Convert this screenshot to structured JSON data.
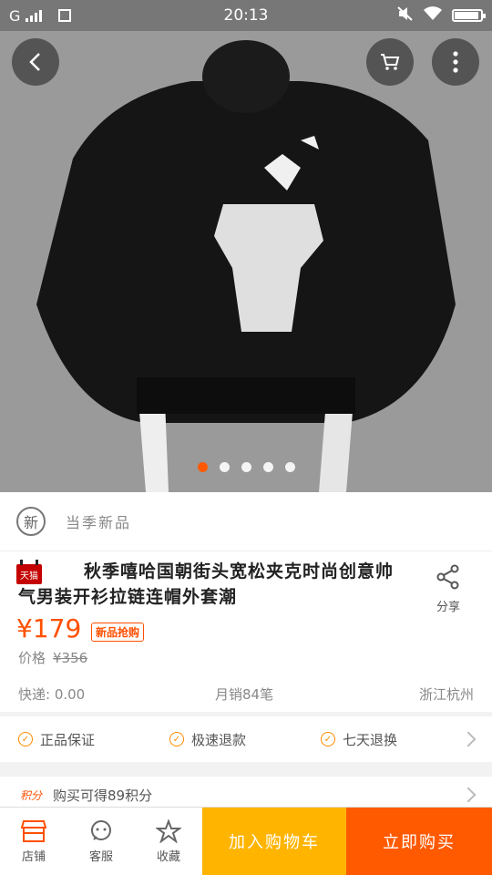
{
  "status": {
    "carrier": "G",
    "time": "20:13"
  },
  "hero": {
    "slides": 5,
    "active": 0
  },
  "new_section": {
    "badge": "新",
    "label": "当季新品"
  },
  "product": {
    "store_badge": "天猫",
    "title": "秋季嘻哈国朝街头宽松夹克时尚创意帅气男装开衫拉链连帽外套潮",
    "share_label": "分享",
    "price": "¥179",
    "price_badge": "新品抢购",
    "orig_label": "价格",
    "orig_price": "¥356",
    "shipping": "快递: 0.00",
    "monthly_sales": "月销84笔",
    "location": "浙江杭州"
  },
  "guarantees": [
    "正品保证",
    "极速退款",
    "七天退换"
  ],
  "points": {
    "tag": "积分",
    "text": "购买可得89积分"
  },
  "bottom": {
    "tabs": [
      {
        "label": "店铺"
      },
      {
        "label": "客服"
      },
      {
        "label": "收藏"
      }
    ],
    "add_to_cart": "加入购物车",
    "buy_now": "立即购买"
  },
  "colors": {
    "accent": "#ff5000",
    "cart": "#ffb400",
    "buy": "#ff5a00"
  }
}
